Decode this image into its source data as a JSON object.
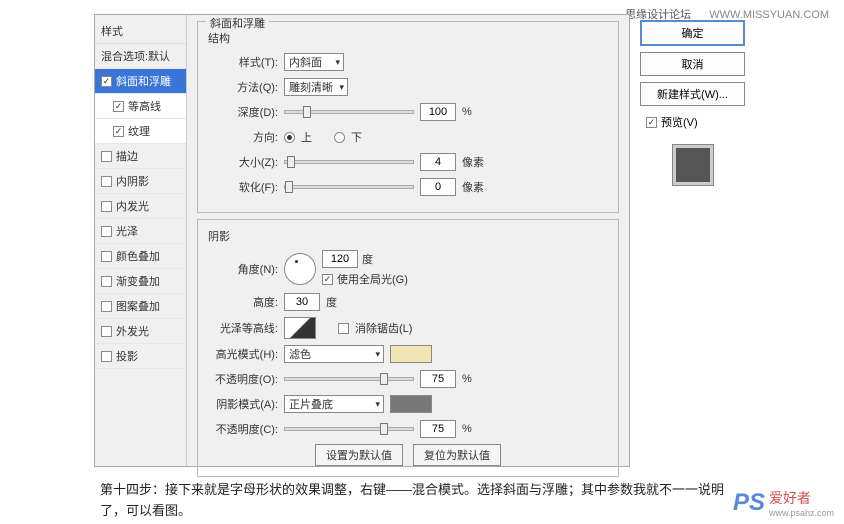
{
  "header": {
    "brand": "思缘设计论坛",
    "url": "WWW.MISSYUAN.COM"
  },
  "left": {
    "title": "样式",
    "blend": "混合选项:默认",
    "items": [
      {
        "label": "斜面和浮雕",
        "checked": true,
        "selected": true
      },
      {
        "label": "等高线",
        "checked": true,
        "sub": true
      },
      {
        "label": "纹理",
        "checked": true,
        "sub": true
      },
      {
        "label": "描边",
        "checked": false
      },
      {
        "label": "内阴影",
        "checked": false
      },
      {
        "label": "内发光",
        "checked": false
      },
      {
        "label": "光泽",
        "checked": false
      },
      {
        "label": "颜色叠加",
        "checked": false
      },
      {
        "label": "渐变叠加",
        "checked": false
      },
      {
        "label": "图案叠加",
        "checked": false
      },
      {
        "label": "外发光",
        "checked": false
      },
      {
        "label": "投影",
        "checked": false
      }
    ]
  },
  "mid": {
    "legend": "斜面和浮雕",
    "structure": {
      "title": "结构",
      "style_label": "样式(T):",
      "style_value": "内斜面",
      "method_label": "方法(Q):",
      "method_value": "雕刻清晰",
      "depth_label": "深度(D):",
      "depth_value": "100",
      "depth_unit": "%",
      "direction_label": "方向:",
      "dir_up": "上",
      "dir_down": "下",
      "size_label": "大小(Z):",
      "size_value": "4",
      "size_unit": "像素",
      "soften_label": "软化(F):",
      "soften_value": "0",
      "soften_unit": "像素"
    },
    "shading": {
      "title": "阴影",
      "angle_label": "角度(N):",
      "angle_value": "120",
      "angle_unit": "度",
      "global_light": "使用全局光(G)",
      "altitude_label": "高度:",
      "altitude_value": "30",
      "altitude_unit": "度",
      "contour_label": "光泽等高线:",
      "antialias": "消除锯齿(L)",
      "highlight_mode_label": "高光模式(H):",
      "highlight_mode_value": "滤色",
      "highlight_opacity_label": "不透明度(O):",
      "highlight_opacity_value": "75",
      "opacity_unit": "%",
      "shadow_mode_label": "阴影模式(A):",
      "shadow_mode_value": "正片叠底",
      "shadow_opacity_label": "不透明度(C):",
      "shadow_opacity_value": "75"
    },
    "btn_default": "设置为默认值",
    "btn_reset": "复位为默认值"
  },
  "right": {
    "ok": "确定",
    "cancel": "取消",
    "new_style": "新建样式(W)...",
    "preview": "预览(V)"
  },
  "caption": "第十四步：接下来就是字母形状的效果调整，右键——混合模式。选择斜面与浮雕；其中参数我就不一一说明了，可以看图。",
  "footer": {
    "ps": "PS",
    "zh": "爱好者",
    "url": "www.psahz.com"
  },
  "colors": {
    "highlight_swatch": "#f0e6b3",
    "shadow_swatch": "#777777"
  }
}
